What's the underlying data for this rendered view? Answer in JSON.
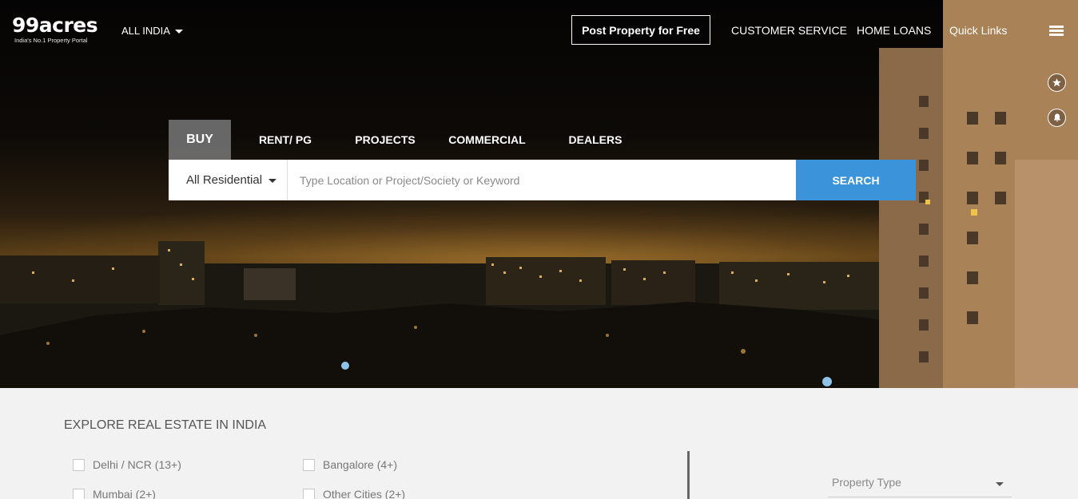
{
  "brand": {
    "name": "99acres",
    "tagline": "India's No.1 Property Portal"
  },
  "header": {
    "region": "ALL INDIA",
    "post_property": "Post Property for Free",
    "links": [
      "CUSTOMER SERVICE",
      "HOME LOANS",
      "Quick Links"
    ]
  },
  "icons": {
    "menu": "hamburger-icon",
    "shortlist": "star-icon",
    "alerts": "bell-icon"
  },
  "search": {
    "tabs": [
      {
        "label": "BUY",
        "active": true
      },
      {
        "label": "RENT/ PG",
        "active": false
      },
      {
        "label": "PROJECTS",
        "active": false
      },
      {
        "label": "COMMERCIAL",
        "active": false
      },
      {
        "label": "DEALERS",
        "active": false
      }
    ],
    "property_category": "All Residential",
    "placeholder": "Type Location or Project/Society or Keyword",
    "button": "SEARCH"
  },
  "explore": {
    "title": "EXPLORE REAL ESTATE IN INDIA",
    "cities": [
      {
        "label": "Delhi / NCR (13+)"
      },
      {
        "label": "Bangalore (4+)"
      },
      {
        "label": "Mumbai (2+)"
      },
      {
        "label": "Other Cities (2+)"
      }
    ],
    "property_type_placeholder": "Property Type"
  },
  "colors": {
    "search_button": "#3b94d9",
    "active_tab": "#787878",
    "page_bg": "#f2f2f2"
  }
}
